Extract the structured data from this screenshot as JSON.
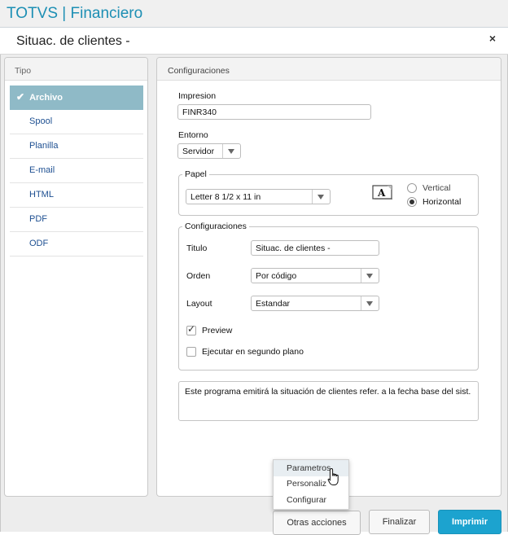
{
  "app": {
    "title": "TOTVS | Financiero"
  },
  "dialog": {
    "title": "Situac. de clientes  -",
    "close_symbol": "×"
  },
  "tipo": {
    "header": "Tipo",
    "items": [
      {
        "label": "Archivo",
        "selected": true
      },
      {
        "label": "Spool"
      },
      {
        "label": "Planilla"
      },
      {
        "label": "E-mail"
      },
      {
        "label": "HTML"
      },
      {
        "label": "PDF"
      },
      {
        "label": "ODF"
      }
    ]
  },
  "config": {
    "header": "Configuraciones",
    "impresion": {
      "label": "Impresion",
      "value": "FINR340"
    },
    "entorno": {
      "label": "Entorno",
      "value": "Servidor"
    },
    "papel": {
      "legend": "Papel",
      "size": "Letter 8 1/2 x 11 in",
      "orientation_options": [
        "Vertical",
        "Horizontal"
      ],
      "orientation_selected": "Horizontal"
    },
    "configuraciones": {
      "legend": "Configuraciones",
      "titulo": {
        "label": "Titulo",
        "value": "Situac. de clientes  -"
      },
      "orden": {
        "label": "Orden",
        "value": "Por código"
      },
      "layout": {
        "label": "Layout",
        "value": "Estandar"
      },
      "preview": {
        "label": "Preview",
        "checked": true
      },
      "background": {
        "label": "Ejecutar en segundo plano",
        "checked": false
      }
    },
    "description": "Este programa emitirá la situación de clientes refer. a la fecha base del sist."
  },
  "popup_menu": {
    "items": [
      "Parametros",
      "Personaliz",
      "Configurar"
    ],
    "hovered": "Parametros"
  },
  "buttons": {
    "other_actions": "Otras acciones",
    "finish": "Finalizar",
    "print": "Imprimir"
  },
  "colors": {
    "brand": "#1d8fb4",
    "selected_item": "#8fbac7",
    "primary_button": "#1ca3cf"
  }
}
